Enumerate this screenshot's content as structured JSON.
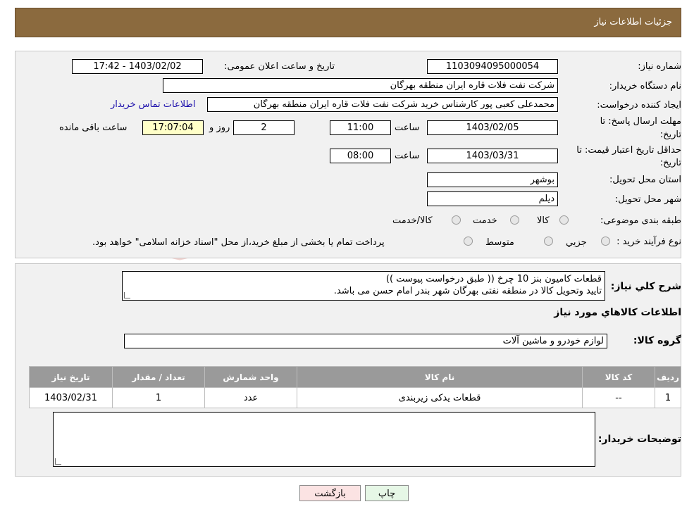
{
  "header": {
    "title": "جزئیات اطلاعات نیاز"
  },
  "form": {
    "need_number_label": "شماره نیاز:",
    "need_number": "1103094095000054",
    "announce_label": "تاریخ و ساعت اعلان عمومی:",
    "announce_value": "1403/02/02 - 17:42",
    "buyer_org_label": "نام دستگاه خریدار:",
    "buyer_org": "شرکت نفت فلات قاره ایران منطقه بهرگان",
    "creator_label": "ایجاد کننده درخواست:",
    "creator": "محمدعلی کعبی پور کارشناس خرید شرکت نفت فلات قاره ایران منطقه بهرگان",
    "contact_link": "اطلاعات تماس خریدار",
    "deadline_label_1": "مهلت ارسال پاسخ: تا",
    "deadline_label_2": "تاریخ:",
    "deadline_date": "1403/02/05",
    "time_label": "ساعت",
    "deadline_time": "11:00",
    "days_remaining": "2",
    "days_label": "روز و",
    "time_remaining": "17:07:04",
    "remaining_label": "ساعت باقی مانده",
    "validity_label_1": "حداقل تاریخ اعتبار قیمت: تا",
    "validity_label_2": "تاریخ:",
    "validity_date": "1403/03/31",
    "validity_time": "08:00",
    "province_label": "استان محل تحویل:",
    "province": "بوشهر",
    "city_label": "شهر محل تحویل:",
    "city": "دیلم",
    "category_label": "طبقه بندی موضوعی:",
    "category_options": [
      "کالا",
      "خدمت",
      "کالا/خدمت"
    ],
    "process_label": "نوع فرآیند خرید :",
    "process_options": [
      "جزیي",
      "متوسط"
    ],
    "process_note": "پرداخت تمام یا بخشی از مبلغ خرید،از محل \"اسناد خزانه اسلامی\" خواهد بود."
  },
  "details": {
    "summary_label": "شرح کلي نياز:",
    "summary_line1": "قطعات کامیون بنز 10 چرخ (( طبق درخواست پیوست ))",
    "summary_line2": "تایید وتحویل کالا در منطقه نفتی بهرگان شهر بندر امام حسن می باشد.",
    "goods_info_title": "اطلاعات کالاهاي مورد نياز",
    "group_label": "گروه کالا:",
    "group_value": "لوازم خودرو و ماشین آلات",
    "table": {
      "headers": [
        "ردیف",
        "کد کالا",
        "نام کالا",
        "واحد شمارش",
        "تعداد / مقدار",
        "تاریخ نیاز"
      ],
      "rows": [
        [
          "1",
          "--",
          "قطعات یدکی زیربندی",
          "عدد",
          "1",
          "1403/02/31"
        ]
      ]
    },
    "buyer_notes_label": "توضیحات خریدار:",
    "buyer_notes": ""
  },
  "buttons": {
    "print": "چاپ",
    "back": "بازگشت"
  },
  "colors": {
    "header_bg": "#8b6a3e",
    "panel_bg": "#f1f1f1",
    "table_header": "#9a9a9a",
    "link": "#1a0dab"
  }
}
